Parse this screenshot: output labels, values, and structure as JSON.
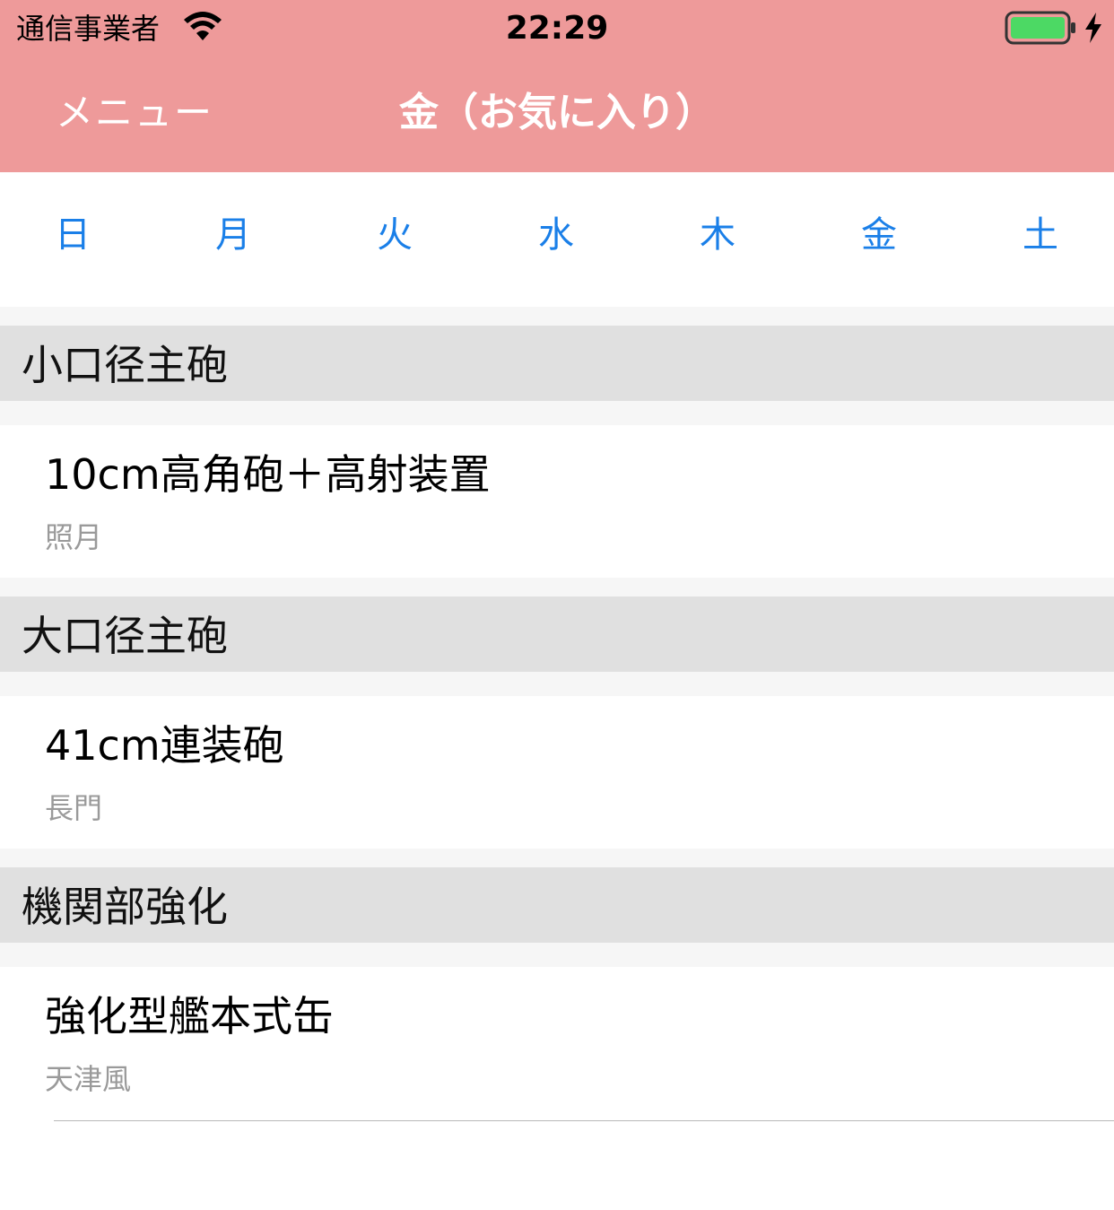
{
  "status_bar": {
    "carrier": "通信事業者",
    "time": "22:29",
    "wifi_icon": "wifi-icon",
    "battery_icon": "battery-icon",
    "charging_icon": "charging-bolt-icon",
    "battery_color": "#4cd964"
  },
  "nav": {
    "menu_label": "メニュー",
    "title": "金（お気に入り）",
    "background_color": "#ee9a9a"
  },
  "day_tabs": {
    "accent_color": "#1a7fe8",
    "items": [
      {
        "label": "日"
      },
      {
        "label": "月"
      },
      {
        "label": "火"
      },
      {
        "label": "水"
      },
      {
        "label": "木"
      },
      {
        "label": "金"
      },
      {
        "label": "土"
      }
    ]
  },
  "sections": [
    {
      "header": "小口径主砲",
      "rows": [
        {
          "title": "10cm高角砲＋高射装置",
          "subtitle": "照月"
        }
      ]
    },
    {
      "header": "大口径主砲",
      "rows": [
        {
          "title": "41cm連装砲",
          "subtitle": "長門"
        }
      ]
    },
    {
      "header": "機関部強化",
      "rows": [
        {
          "title": "強化型艦本式缶",
          "subtitle": "天津風"
        }
      ]
    }
  ]
}
